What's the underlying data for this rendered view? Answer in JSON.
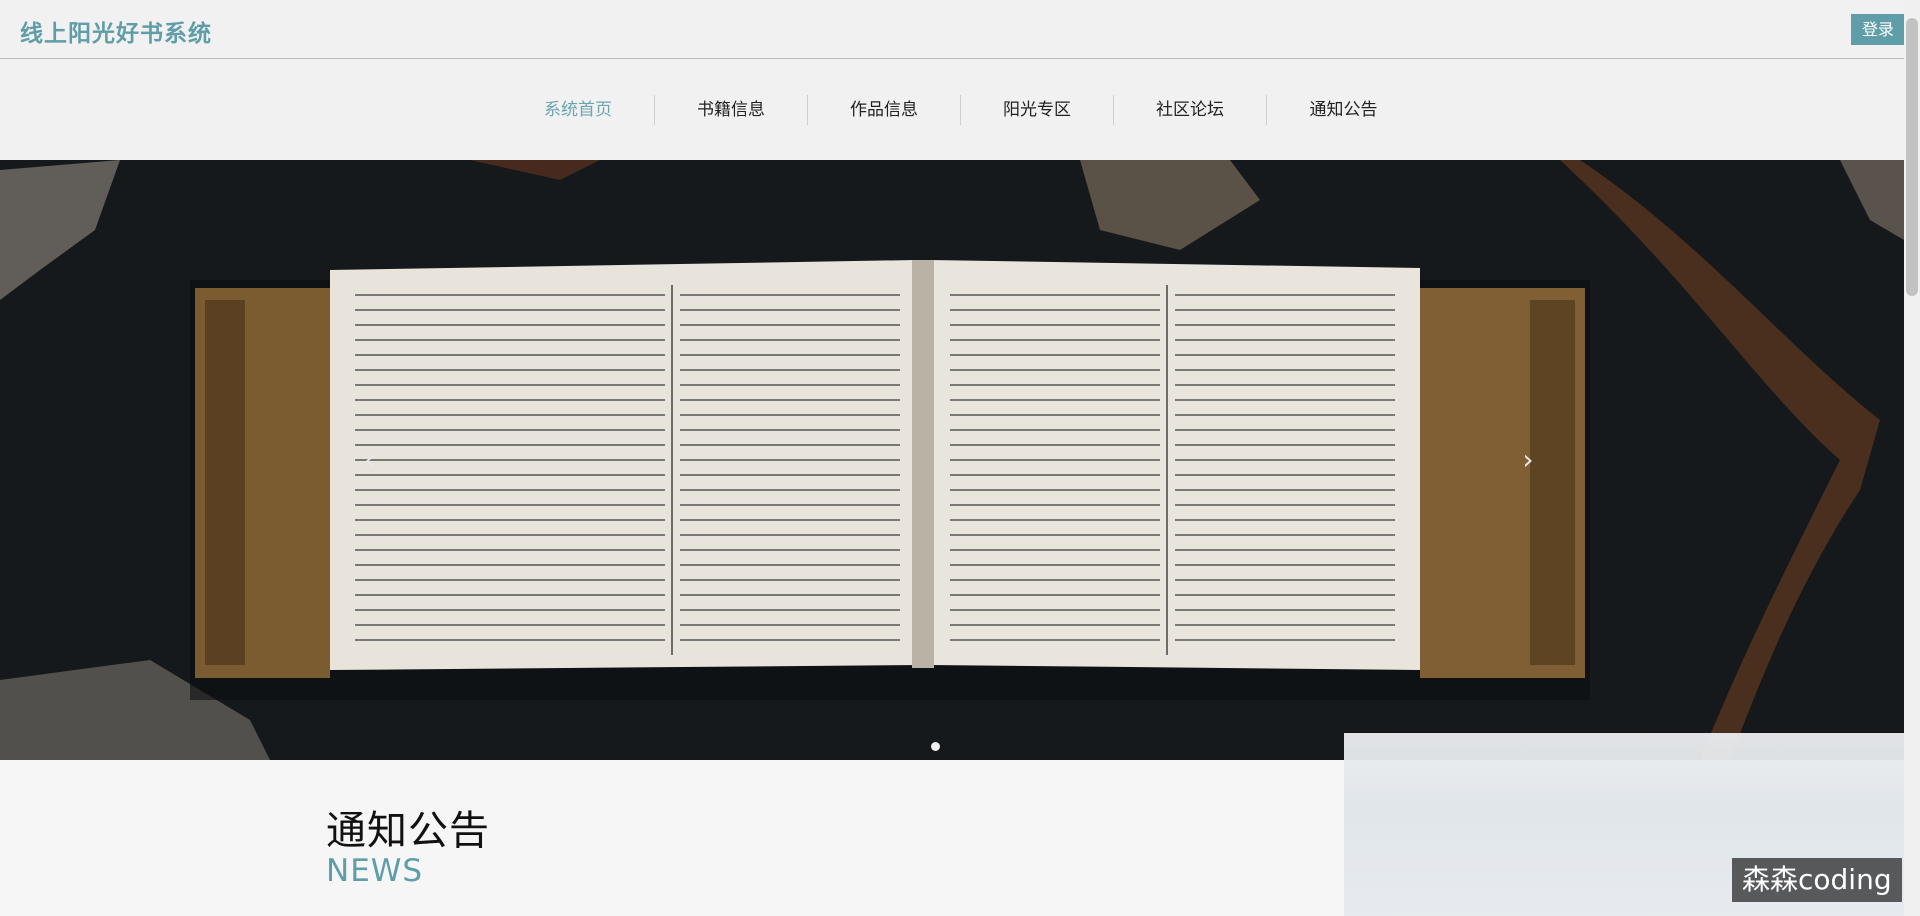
{
  "header": {
    "site_title": "线上阳光好书系统",
    "login_label": "登录"
  },
  "nav": {
    "items": [
      {
        "label": "系统首页",
        "active": true
      },
      {
        "label": "书籍信息",
        "active": false
      },
      {
        "label": "作品信息",
        "active": false
      },
      {
        "label": "阳光专区",
        "active": false
      },
      {
        "label": "社区论坛",
        "active": false
      },
      {
        "label": "通知公告",
        "active": false
      }
    ]
  },
  "carousel": {
    "prev_icon": "chevron-left-icon",
    "next_icon": "chevron-right-icon",
    "slide_count": 1,
    "active_slide": 1,
    "image_subject": "open-book"
  },
  "news_section": {
    "title": "通知公告",
    "subtitle": "NEWS"
  },
  "overlay": {
    "watermark": "森森coding"
  },
  "colors": {
    "brand": "#5f9ea8",
    "nav_active": "#6aa5b0",
    "banner_bg": "#15191c"
  }
}
